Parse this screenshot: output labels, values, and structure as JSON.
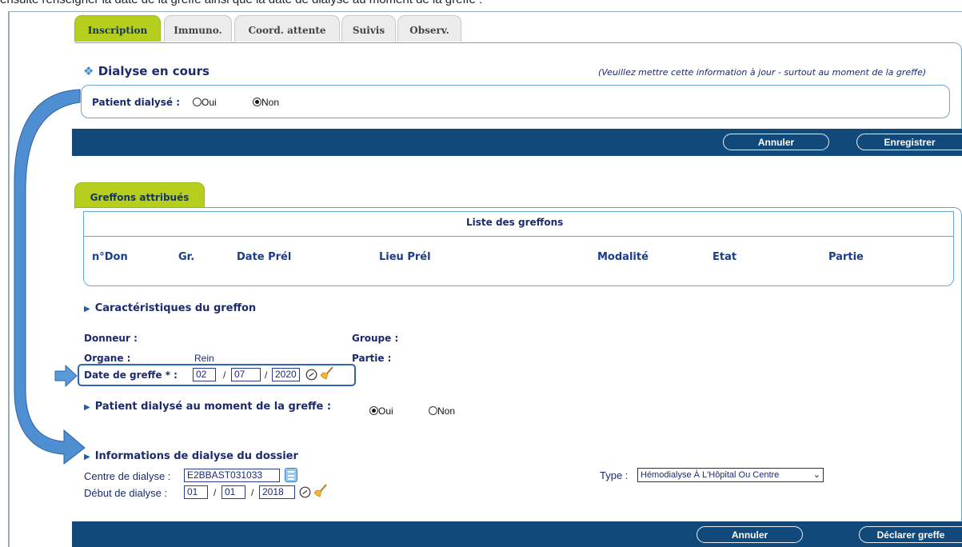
{
  "caption": "ensuite renseigner la date de la greffe ainsi que la date de dialyse au moment de la greffe :",
  "tabs_top": [
    {
      "label": "Inscription",
      "active": true
    },
    {
      "label": "Immuno.",
      "active": false
    },
    {
      "label": "Coord. attente",
      "active": false
    },
    {
      "label": "Suivis",
      "active": false
    },
    {
      "label": "Observ.",
      "active": false
    }
  ],
  "dialyse": {
    "title": "Dialyse en cours",
    "note": "(Veuillez mettre cette information à jour - surtout au moment de la greffe)",
    "patient_label": "Patient dialysé :",
    "oui": "Oui",
    "non": "Non",
    "selected": "Non"
  },
  "buttons_top": {
    "annuler": "Annuler",
    "enregistrer": "Enregistrer"
  },
  "tab_greffons": "Greffons attribués",
  "liste": {
    "title": "Liste des greffons",
    "columns": [
      "n°Don",
      "Gr.",
      "Date Prél",
      "Lieu Prél",
      "Modalité",
      "Etat",
      "Partie"
    ]
  },
  "caracteristiques": {
    "heading": "Caractéristiques du greffon",
    "donneur_label": "Donneur :",
    "groupe_label": "Groupe :",
    "organe_label": "Organe :",
    "organe_value": "Rein",
    "partie_label": "Partie :",
    "date_label": "Date de greffe * :",
    "date_day": "02",
    "date_month": "07",
    "date_year": "2020"
  },
  "dialyse_greffe": {
    "heading": "Patient dialysé au moment de la greffe :",
    "oui": "Oui",
    "non": "Non",
    "selected": "Oui"
  },
  "infos_dialyse": {
    "heading": "Informations de dialyse du dossier",
    "centre_label": "Centre de dialyse :",
    "centre_value": "E2BBAST031033",
    "debut_label": "Début de dialyse :",
    "debut_day": "01",
    "debut_month": "01",
    "debut_year": "2018",
    "type_label": "Type :",
    "type_value": "Hémodialyse À L'Hôpital Ou Centre"
  },
  "buttons_bottom": {
    "annuler": "Annuler",
    "declarer": "Déclarer greffe"
  },
  "colors": {
    "tab_active": "#b6cf1f",
    "bar": "#11497a",
    "accent_arrow": "#3d7ec7",
    "panel_border": "#6aa9cf"
  }
}
